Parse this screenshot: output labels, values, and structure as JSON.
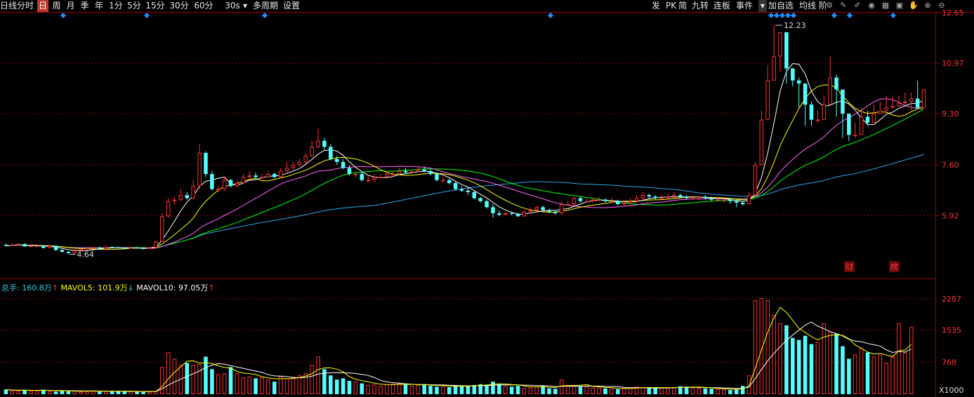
{
  "toolbar": {
    "left_items": [
      "日线",
      "分时",
      "日",
      "周",
      "月",
      "季",
      "年",
      "1分",
      "5分",
      "15分",
      "30分",
      "60分",
      "30s",
      "多周期",
      "设置"
    ],
    "active_item": "日",
    "right_items": [
      "发",
      "PK",
      "简",
      "九转",
      "连板",
      "事件",
      "加自选",
      "均线",
      "阶"
    ],
    "dropdown_glyph": "▼",
    "icons": [
      "settings-gear-icon",
      "draw-pen-icon",
      "brush-icon",
      "eye-icon",
      "calendar-icon",
      "save-icon",
      "hand-icon",
      "zoom-in-icon",
      "zoom-out-icon"
    ]
  },
  "colors": {
    "up": "#ff3232",
    "down": "#54ffff",
    "ma5": "#ffffff",
    "ma10": "#ffff00",
    "ma20": "#ff66ff",
    "ma30": "#00ff00",
    "ma60": "#2ea8e6",
    "grid": "#8b0000",
    "axis_text": "#ff3232",
    "diamond": "#1e90ff"
  },
  "chart_data": {
    "type": "candlestick",
    "price_axis": {
      "ticks": [
        "12.65",
        "10.97",
        "9.30",
        "7.60",
        "5.92"
      ],
      "ylim": [
        4.0,
        12.65
      ]
    },
    "annotations": {
      "high_label": "12.23",
      "low_label": "4.64"
    },
    "markers": [
      "财",
      "榜"
    ],
    "candles": {
      "o": [
        4.95,
        4.92,
        4.95,
        4.98,
        4.9,
        4.92,
        4.92,
        4.85,
        4.92,
        4.78,
        4.72,
        4.68,
        4.76,
        4.8,
        4.84,
        4.86,
        4.82,
        4.88,
        4.86,
        4.85,
        4.84,
        4.86,
        4.84,
        4.82,
        4.86,
        5.06,
        5.9,
        6.4,
        6.45,
        6.6,
        6.5,
        6.9,
        8.0,
        7.3,
        6.8,
        6.8,
        7.1,
        6.9,
        7.0,
        7.2,
        7.25,
        7.2,
        7.2,
        7.3,
        7.2,
        7.4,
        7.5,
        7.6,
        7.7,
        7.9,
        8.2,
        8.4,
        8.2,
        7.8,
        7.7,
        7.5,
        7.3,
        7.3,
        7.1,
        7.1,
        7.2,
        7.2,
        7.3,
        7.3,
        7.4,
        7.35,
        7.38,
        7.45,
        7.4,
        7.3,
        7.1,
        7.1,
        7.0,
        6.8,
        6.75,
        6.7,
        6.5,
        6.4,
        6.2,
        6.0,
        5.95,
        6.0,
        5.98,
        5.9,
        6.05,
        6.1,
        6.2,
        6.1,
        6.05,
        6.0,
        6.3,
        6.3,
        6.5,
        6.4,
        6.4,
        6.45,
        6.45,
        6.4,
        6.4,
        6.3,
        6.35,
        6.4,
        6.5,
        6.6,
        6.55,
        6.5,
        6.5,
        6.55,
        6.6,
        6.55,
        6.5,
        6.5,
        6.55,
        6.5,
        6.45,
        6.45,
        6.45,
        6.4,
        6.35,
        6.3,
        6.6,
        7.6,
        9.1,
        10.4,
        11.2,
        12.0,
        10.8,
        10.4,
        10.3,
        9.6,
        9.1,
        9.1,
        9.6,
        10.5,
        10.1,
        9.3,
        8.6,
        8.6,
        9.2,
        9.0,
        9.3,
        9.4,
        9.5,
        9.55,
        9.65,
        9.7,
        9.8,
        9.5
      ],
      "c": [
        4.92,
        4.95,
        4.98,
        4.9,
        4.92,
        4.92,
        4.85,
        4.92,
        4.78,
        4.72,
        4.68,
        4.76,
        4.8,
        4.84,
        4.86,
        4.82,
        4.88,
        4.86,
        4.85,
        4.84,
        4.86,
        4.84,
        4.82,
        4.86,
        5.06,
        5.9,
        6.4,
        6.45,
        6.6,
        6.5,
        6.9,
        8.0,
        7.3,
        6.8,
        6.8,
        7.1,
        6.9,
        7.0,
        7.2,
        7.25,
        7.2,
        7.2,
        7.3,
        7.2,
        7.4,
        7.5,
        7.6,
        7.7,
        7.9,
        8.2,
        8.4,
        8.2,
        7.8,
        7.7,
        7.5,
        7.3,
        7.3,
        7.1,
        7.1,
        7.2,
        7.2,
        7.3,
        7.3,
        7.4,
        7.35,
        7.38,
        7.45,
        7.4,
        7.3,
        7.1,
        7.1,
        7.0,
        6.8,
        6.75,
        6.7,
        6.5,
        6.4,
        6.2,
        6.0,
        5.95,
        6.0,
        5.98,
        5.9,
        6.05,
        6.1,
        6.2,
        6.1,
        6.05,
        6.0,
        6.3,
        6.3,
        6.5,
        6.4,
        6.4,
        6.45,
        6.45,
        6.4,
        6.4,
        6.3,
        6.35,
        6.4,
        6.5,
        6.6,
        6.55,
        6.5,
        6.5,
        6.55,
        6.6,
        6.55,
        6.5,
        6.5,
        6.55,
        6.5,
        6.45,
        6.45,
        6.45,
        6.4,
        6.35,
        6.3,
        6.6,
        7.6,
        9.1,
        10.4,
        11.2,
        12.0,
        10.8,
        10.4,
        10.3,
        9.6,
        9.1,
        9.1,
        9.6,
        10.5,
        10.1,
        9.3,
        8.6,
        8.6,
        9.2,
        9.0,
        9.3,
        9.4,
        9.5,
        9.55,
        9.65,
        9.7,
        9.8,
        9.5,
        10.1
      ],
      "h": [
        5.0,
        5.0,
        5.02,
        5.0,
        4.96,
        4.96,
        4.94,
        4.96,
        4.94,
        4.82,
        4.74,
        4.8,
        4.84,
        4.88,
        4.9,
        4.9,
        4.92,
        4.9,
        4.9,
        4.88,
        4.9,
        4.9,
        4.88,
        4.9,
        5.1,
        6.0,
        6.5,
        6.55,
        6.8,
        6.7,
        7.1,
        8.3,
        8.05,
        7.4,
        6.9,
        7.2,
        7.15,
        7.1,
        7.3,
        7.4,
        7.35,
        7.3,
        7.4,
        7.35,
        7.5,
        7.7,
        7.7,
        7.8,
        8.0,
        8.4,
        8.8,
        8.5,
        8.3,
        7.9,
        7.8,
        7.6,
        7.4,
        7.4,
        7.25,
        7.3,
        7.3,
        7.4,
        7.4,
        7.5,
        7.5,
        7.45,
        7.55,
        7.55,
        7.45,
        7.35,
        7.2,
        7.15,
        7.05,
        6.9,
        6.85,
        6.75,
        6.55,
        6.45,
        6.3,
        6.1,
        6.05,
        6.05,
        6.02,
        6.1,
        6.2,
        6.25,
        6.25,
        6.15,
        6.1,
        6.4,
        6.4,
        6.55,
        6.55,
        6.5,
        6.5,
        6.55,
        6.5,
        6.5,
        6.45,
        6.45,
        6.5,
        6.6,
        6.7,
        6.65,
        6.6,
        6.6,
        6.65,
        6.7,
        6.65,
        6.6,
        6.6,
        6.6,
        6.6,
        6.55,
        6.55,
        6.5,
        6.5,
        6.4,
        6.4,
        6.7,
        7.7,
        9.4,
        10.9,
        12.23,
        12.0,
        11.7,
        10.7,
        10.5,
        10.3,
        9.7,
        9.4,
        9.9,
        11.2,
        10.6,
        9.5,
        8.8,
        9.0,
        9.5,
        9.4,
        9.6,
        9.7,
        9.9,
        9.9,
        9.9,
        10.0,
        10.0,
        10.4
      ],
      "l": [
        4.9,
        4.9,
        4.92,
        4.88,
        4.87,
        4.9,
        4.83,
        4.84,
        4.75,
        4.7,
        4.64,
        4.66,
        4.74,
        4.78,
        4.82,
        4.8,
        4.8,
        4.84,
        4.83,
        4.82,
        4.82,
        4.82,
        4.8,
        4.8,
        4.84,
        5.05,
        5.85,
        6.3,
        6.4,
        6.45,
        6.45,
        6.8,
        7.2,
        6.75,
        6.7,
        6.75,
        6.85,
        6.85,
        6.95,
        7.15,
        7.15,
        7.15,
        7.15,
        7.15,
        7.15,
        7.35,
        7.45,
        7.55,
        7.65,
        7.85,
        8.15,
        8.1,
        7.75,
        7.6,
        7.45,
        7.25,
        7.2,
        7.05,
        7.0,
        7.05,
        7.15,
        7.15,
        7.25,
        7.25,
        7.3,
        7.3,
        7.35,
        7.35,
        7.25,
        7.05,
        7.0,
        6.95,
        6.75,
        6.7,
        6.6,
        6.45,
        6.35,
        6.15,
        5.85,
        5.9,
        5.93,
        5.92,
        5.88,
        5.88,
        6.0,
        6.05,
        6.05,
        6.0,
        5.95,
        5.95,
        6.25,
        6.25,
        6.35,
        6.35,
        6.35,
        6.4,
        6.35,
        6.35,
        6.25,
        6.25,
        6.3,
        6.35,
        6.45,
        6.5,
        6.45,
        6.45,
        6.45,
        6.5,
        6.5,
        6.45,
        6.45,
        6.45,
        6.45,
        6.4,
        6.4,
        6.35,
        6.3,
        6.2,
        6.25,
        6.55,
        7.55,
        9.0,
        10.3,
        11.1,
        10.7,
        10.3,
        10.2,
        9.5,
        8.9,
        8.9,
        9.0,
        9.5,
        10.0,
        9.2,
        8.5,
        8.4,
        8.5,
        8.9,
        8.9,
        9.2,
        9.3,
        9.4,
        9.5,
        9.6,
        9.6,
        9.4,
        9.45
      ]
    },
    "volume": {
      "legend": {
        "main_label": "总手:",
        "main_value": "160.8万",
        "main_arrow": "↑",
        "ma5_label": "MAVOL5:",
        "ma5_value": "101.9万",
        "ma5_arrow": "↓",
        "ma10_label": "MAVOL10:",
        "ma10_value": "97.05万",
        "ma10_arrow": "↑"
      },
      "axis_ticks": [
        "2287",
        "1535",
        "768"
      ],
      "unit_label": "X1000",
      "ylim": [
        0,
        2420
      ],
      "values": [
        110,
        90,
        80,
        100,
        80,
        90,
        110,
        70,
        60,
        90,
        70,
        80,
        60,
        70,
        90,
        60,
        80,
        60,
        70,
        60,
        70,
        60,
        50,
        60,
        80,
        650,
        1000,
        850,
        700,
        750,
        700,
        720,
        900,
        600,
        480,
        500,
        650,
        500,
        400,
        420,
        380,
        400,
        350,
        300,
        430,
        380,
        420,
        450,
        500,
        700,
        900,
        600,
        450,
        350,
        380,
        320,
        300,
        260,
        220,
        230,
        200,
        240,
        250,
        260,
        230,
        200,
        220,
        240,
        200,
        180,
        190,
        170,
        210,
        190,
        200,
        220,
        240,
        230,
        300,
        250,
        200,
        180,
        200,
        150,
        160,
        180,
        200,
        140,
        130,
        350,
        220,
        200,
        180,
        190,
        160,
        150,
        140,
        130,
        120,
        140,
        160,
        180,
        170,
        150,
        140,
        160,
        150,
        170,
        190,
        180,
        160,
        150,
        140,
        130,
        120,
        110,
        100,
        120,
        200,
        450,
        2250,
        2300,
        2250,
        1900,
        1700,
        1650,
        1350,
        1300,
        1400,
        1200,
        1250,
        1700,
        1500,
        1450,
        1150,
        850,
        950,
        1100,
        1000,
        900,
        950,
        750,
        900,
        1700,
        1000,
        1608
      ]
    },
    "moving_averages": [
      "MA5",
      "MA10",
      "MA20",
      "MA30",
      "MA60"
    ]
  }
}
